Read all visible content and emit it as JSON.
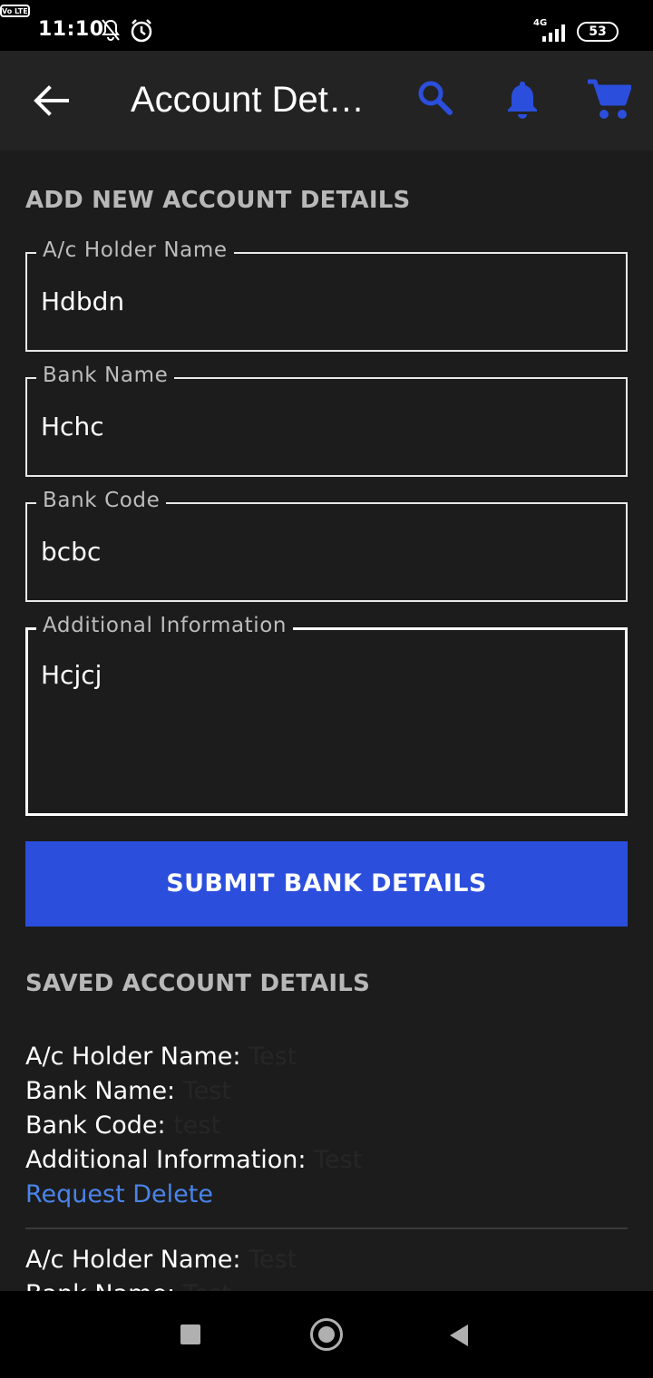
{
  "status_bar": {
    "time": "11:10",
    "network_badge": "Vo LTE",
    "network_type": "4G",
    "battery": "53",
    "icons": [
      "bell-off-icon",
      "alarm-icon",
      "signal-icon"
    ]
  },
  "app_bar": {
    "title": "Account Details",
    "icons": [
      "back-arrow-icon",
      "search-icon",
      "bell-icon",
      "cart-icon"
    ]
  },
  "colors": {
    "background": "#1c1c1c",
    "app_bar": "#232323",
    "accent": "#2b4edc",
    "link": "#4a84ea",
    "section_title": "#b8b8b8"
  },
  "form": {
    "section_title": "ADD NEW ACCOUNT DETAILS",
    "fields": [
      {
        "label": "A/c Holder Name",
        "value": "Hdbdn"
      },
      {
        "label": "Bank Name",
        "value": "Hchc"
      },
      {
        "label": "Bank Code",
        "value": "bcbc"
      },
      {
        "label": "Additional Information",
        "value": "Hcjcj"
      }
    ],
    "submit_label": "SUBMIT BANK DETAILS"
  },
  "saved": {
    "section_title": "SAVED ACCOUNT DETAILS",
    "request_delete_label": "Request Delete",
    "accounts": [
      {
        "holder_label": "A/c Holder Name:",
        "holder_value": "Test",
        "bank_label": "Bank Name:",
        "bank_value": "Test",
        "code_label": "Bank Code:",
        "code_value": "test",
        "info_label": "Additional Information:",
        "info_value": "Test"
      },
      {
        "holder_label": "A/c Holder Name:",
        "holder_value": "Test",
        "bank_label": "Bank Name:",
        "bank_value": "Test"
      }
    ]
  },
  "nav_bar": {
    "icons": [
      "recents-square-icon",
      "home-circle-icon",
      "back-triangle-icon"
    ]
  }
}
